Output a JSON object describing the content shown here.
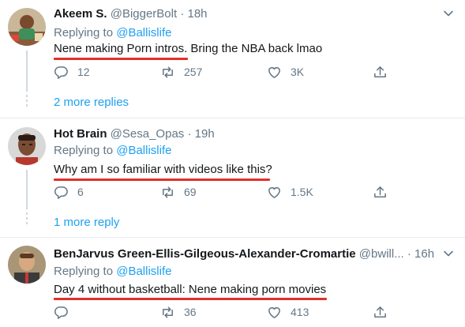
{
  "tweets": [
    {
      "name": "Akeem S.",
      "handle": "@BiggerBolt",
      "time": "18h",
      "replying_prefix": "Replying to",
      "replying_handle": "@Ballislife",
      "text": "Nene making Porn intros. Bring the NBA back lmao",
      "replies": "12",
      "retweets": "257",
      "likes": "3K",
      "more_replies": "2 more replies"
    },
    {
      "name": "Hot Brain",
      "handle": "@Sesa_Opas",
      "time": "19h",
      "replying_prefix": "Replying to",
      "replying_handle": "@Ballislife",
      "text": "Why am I so familiar with videos like this?",
      "replies": "6",
      "retweets": "69",
      "likes": "1.5K",
      "more_replies": "1 more reply"
    },
    {
      "name": "BenJarvus Green-Ellis-Gilgeous-Alexander-Cromartie",
      "handle": "@bwill...",
      "time": "16h",
      "replying_prefix": "Replying to",
      "replying_handle": "@Ballislife",
      "text": "Day 4 without basketball: Nene making porn movies",
      "replies": "",
      "retweets": "36",
      "likes": "413"
    }
  ],
  "separator": "·",
  "colors": {
    "accent": "#1da1f2",
    "muted": "#657786",
    "highlight_underline": "#e0302a"
  },
  "icons": [
    "reply-icon",
    "retweet-icon",
    "like-icon",
    "share-icon",
    "chevron-down-icon"
  ]
}
